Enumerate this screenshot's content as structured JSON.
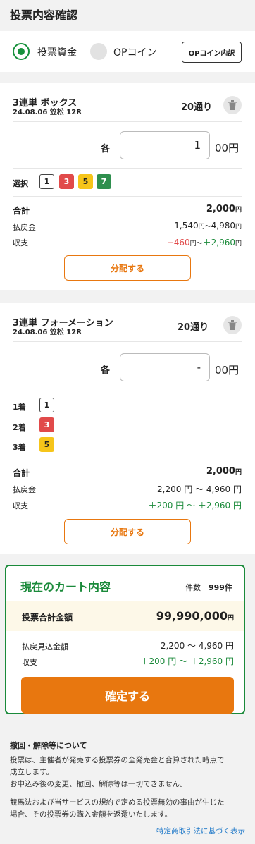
{
  "header": {
    "title": "投票内容確認"
  },
  "funding": {
    "option1": "投票資金",
    "option2": "OPコイン",
    "detail_button": "OPコイン内訳"
  },
  "bet1": {
    "title": "3連単 ボックス",
    "race": "24.08.06 笠松 12R",
    "count": "20通り",
    "each_label": "各",
    "amount": "1",
    "unit": "00円",
    "select_label": "選択",
    "chips": [
      "1",
      "3",
      "5",
      "7"
    ],
    "total_label": "合計",
    "total_value": "2,000",
    "total_unit": "円",
    "payout_label": "払戻金",
    "payout_from": "1,540",
    "payout_mid": "円～",
    "payout_to": "4,980",
    "payout_unit": "円",
    "balance_label": "収支",
    "balance_from": "−460",
    "balance_mid": "円～",
    "balance_to": "＋2,960",
    "balance_unit": "円",
    "distribute_button": "分配する"
  },
  "bet2": {
    "title": "3連単 フォーメーション",
    "race": "24.08.06 笠松 12R",
    "count": "20通り",
    "each_label": "各",
    "amount": "-",
    "unit": "00円",
    "place1_label": "1着",
    "place1_chip": "1",
    "place2_label": "2着",
    "place2_chip": "3",
    "place3_label": "3着",
    "place3_chip": "5",
    "total_label": "合計",
    "total_value": "2,000",
    "total_unit": "円",
    "payout_label": "払戻金",
    "payout_text": "2,200 円 ～ 4,960 円",
    "balance_label": "収支",
    "balance_text": "＋200 円 ～ ＋2,960 円",
    "distribute_button": "分配する"
  },
  "cart": {
    "title": "現在のカート内容",
    "count_label": "件数",
    "count_value": "999件",
    "total_label": "投票合計金額",
    "total_value": "99,990,000",
    "total_unit": "円",
    "payout_label": "払戻見込金額",
    "payout_text": "2,200 ～ 4,960 円",
    "balance_label": "収支",
    "balance_text": "＋200 円 ～ ＋2,960 円",
    "confirm_button": "確定する"
  },
  "notes": {
    "title": "撤回・解除等について",
    "p1_line1": "投票は、主催者が発売する投票券の全発売金と合算された時点で",
    "p1_line2": "成立します。",
    "p1_line3": "お申込み後の変更、撤回、解除等は一切できません。",
    "p2_line1": "競馬法および当サービスの規約で定める投票無効の事由が生じた",
    "p2_line2": "場合、その投票券の購入金額を返還いたします。",
    "link": "特定商取引法に基づく表示"
  },
  "colors": {
    "green": "#1a8a3a",
    "orange": "#e8770f",
    "red": "#e14a4a",
    "yellow": "#f6c51a"
  }
}
